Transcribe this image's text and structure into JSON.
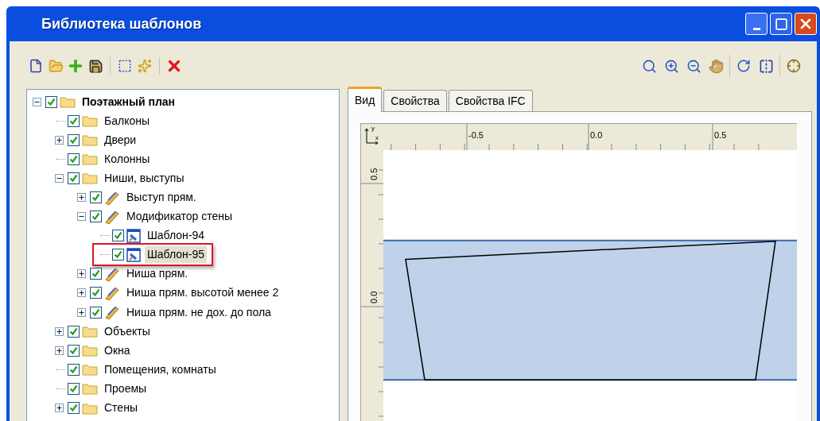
{
  "window": {
    "title": "Библиотека шаблонов"
  },
  "tree": [
    {
      "label": "Поэтажный план",
      "kind": "folder",
      "expandable": true,
      "expanded": true,
      "checked": true,
      "selected": false,
      "bold": true,
      "children": [
        {
          "label": "Балконы",
          "kind": "folder",
          "expandable": false,
          "checked": true,
          "selected": false,
          "bold": false
        },
        {
          "label": "Двери",
          "kind": "folder",
          "expandable": true,
          "expanded": false,
          "checked": true,
          "selected": false,
          "bold": false
        },
        {
          "label": "Колонны",
          "kind": "folder",
          "expandable": false,
          "checked": true,
          "selected": false,
          "bold": false
        },
        {
          "label": "Ниши, выступы",
          "kind": "folder",
          "expandable": true,
          "expanded": true,
          "checked": true,
          "selected": false,
          "bold": false,
          "children": [
            {
              "label": "Выступ прям.",
              "kind": "modifier",
              "expandable": true,
              "expanded": false,
              "checked": true,
              "selected": false,
              "bold": false
            },
            {
              "label": "Модификатор стены",
              "kind": "modifier",
              "expandable": true,
              "expanded": true,
              "checked": true,
              "selected": false,
              "bold": false,
              "children": [
                {
                  "label": "Шаблон-94",
                  "kind": "template",
                  "expandable": false,
                  "checked": true,
                  "selected": false,
                  "bold": false
                },
                {
                  "label": "Шаблон-95",
                  "kind": "template",
                  "expandable": false,
                  "checked": true,
                  "selected": true,
                  "bold": false
                }
              ]
            },
            {
              "label": "Ниша прям.",
              "kind": "modifier",
              "expandable": true,
              "expanded": false,
              "checked": true,
              "selected": false,
              "bold": false
            },
            {
              "label": "Ниша прям. высотой менее 2",
              "kind": "modifier",
              "expandable": true,
              "expanded": false,
              "checked": true,
              "selected": false,
              "bold": false
            },
            {
              "label": "Ниша прям. не дох. до пола",
              "kind": "modifier",
              "expandable": true,
              "expanded": false,
              "checked": true,
              "selected": false,
              "bold": false
            }
          ]
        },
        {
          "label": "Объекты",
          "kind": "folder",
          "expandable": true,
          "expanded": false,
          "checked": true,
          "selected": false,
          "bold": false
        },
        {
          "label": "Окна",
          "kind": "folder",
          "expandable": true,
          "expanded": false,
          "checked": true,
          "selected": false,
          "bold": false
        },
        {
          "label": "Помещения, комнаты",
          "kind": "folder",
          "expandable": false,
          "checked": true,
          "selected": false,
          "bold": false
        },
        {
          "label": "Проемы",
          "kind": "folder",
          "expandable": false,
          "checked": true,
          "selected": false,
          "bold": false
        },
        {
          "label": "Стены",
          "kind": "folder",
          "expandable": true,
          "expanded": false,
          "checked": true,
          "selected": false,
          "bold": false
        }
      ]
    }
  ],
  "tabs": [
    {
      "label": "Вид",
      "selected": true
    },
    {
      "label": "Свойства",
      "selected": false
    },
    {
      "label": "Свойства IFC",
      "selected": false
    }
  ],
  "view": {
    "axis_x": "x",
    "axis_y": "y",
    "x_ruler": [
      "-0.5",
      "0.0",
      "0.5"
    ],
    "y_ruler": [
      "0.5",
      "0.0"
    ]
  }
}
